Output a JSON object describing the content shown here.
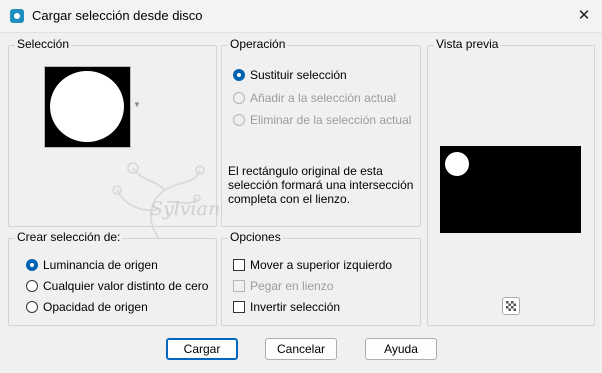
{
  "window": {
    "title": "Cargar selección desde disco",
    "close_glyph": "✕"
  },
  "seleccion": {
    "label": "Selección"
  },
  "operacion": {
    "label": "Operación",
    "options": [
      {
        "label": "Sustituir selección",
        "selected": true,
        "disabled": false
      },
      {
        "label": "Añadir a la selección actual",
        "selected": false,
        "disabled": true
      },
      {
        "label": "Eliminar de la selección actual",
        "selected": false,
        "disabled": true
      }
    ],
    "info": "El rectángulo original de esta selección formará una intersección completa con el lienzo."
  },
  "vista_previa": {
    "label": "Vista previa"
  },
  "crear": {
    "label": "Crear selección de:",
    "options": [
      {
        "label": "Luminancia de origen",
        "selected": true
      },
      {
        "label": "Cualquier valor distinto de cero",
        "selected": false
      },
      {
        "label": "Opacidad de origen",
        "selected": false
      }
    ]
  },
  "opciones": {
    "label": "Opciones",
    "items": [
      {
        "label": "Mover a superior izquierdo",
        "checked": false,
        "disabled": false
      },
      {
        "label": "Pegar en lienzo",
        "checked": false,
        "disabled": true
      },
      {
        "label": "Invertir selección",
        "checked": false,
        "disabled": false
      }
    ]
  },
  "buttons": {
    "load": "Cargar",
    "cancel": "Cancelar",
    "help": "Ayuda"
  },
  "watermark": {
    "text": "Sylviane"
  },
  "icons": {
    "app": "selection-icon",
    "close": "close-icon",
    "checker": "checkerboard-icon",
    "dropdown": "chevron-down-icon"
  },
  "colors": {
    "accent": "#0063b1",
    "default_button_border": "#0067c0"
  }
}
